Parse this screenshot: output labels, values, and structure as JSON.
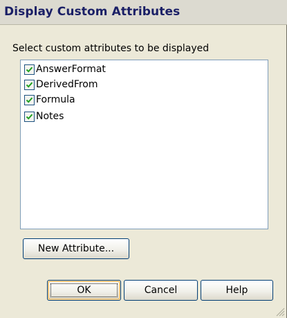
{
  "dialog": {
    "title": "Display Custom Attributes",
    "prompt": "Select custom attributes to be displayed"
  },
  "attributes": [
    {
      "label": "AnswerFormat",
      "checked": true
    },
    {
      "label": "DerivedFrom",
      "checked": true
    },
    {
      "label": "Formula",
      "checked": true
    },
    {
      "label": "Notes",
      "checked": true
    }
  ],
  "buttons": {
    "new_attribute": "New Attribute...",
    "ok": "OK",
    "cancel": "Cancel",
    "help": "Help"
  },
  "icons": {
    "checkmark": "checkmark-icon",
    "resize_grip": "resize-grip-icon"
  },
  "colors": {
    "title_text": "#1a1f66",
    "dialog_background": "#ece9d8",
    "checkmark": "#21a121",
    "list_border": "#7f9db9",
    "button_border": "#003c74"
  }
}
